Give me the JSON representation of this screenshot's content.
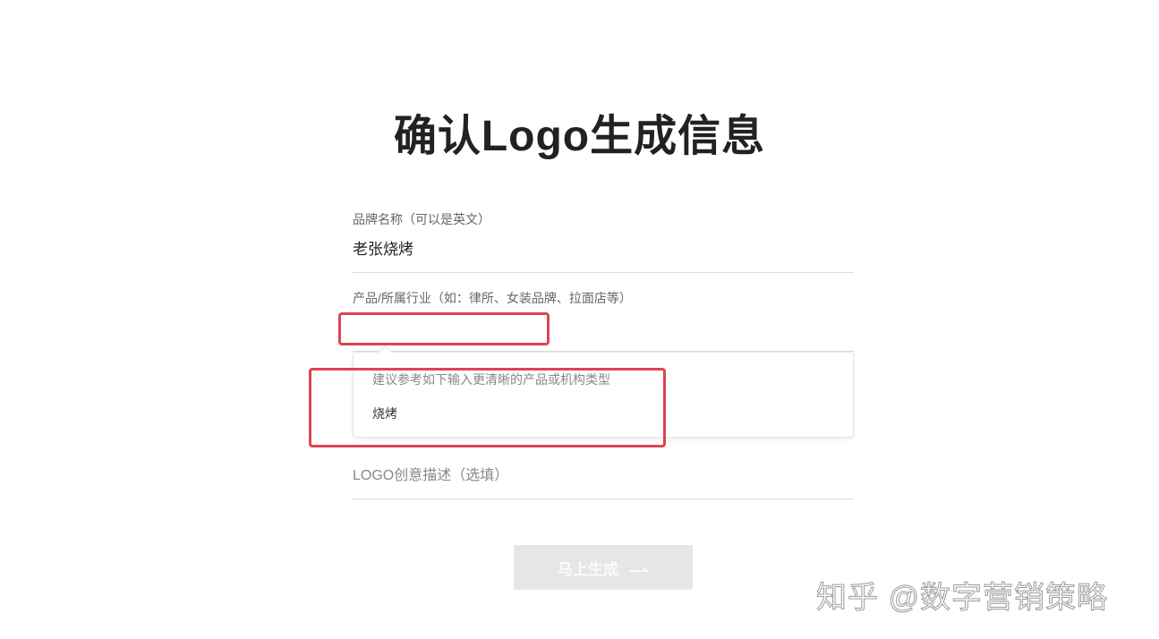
{
  "page": {
    "title": "确认Logo生成信息"
  },
  "form": {
    "brand": {
      "label": "品牌名称（可以是英文）",
      "value": "老张烧烤"
    },
    "industry": {
      "label": "产品/所属行业（如：律所、女装品牌、拉面店等）",
      "value": ""
    },
    "suggestions": {
      "hint": "建议参考如下输入更清晰的产品或机构类型",
      "items": [
        "烧烤"
      ]
    },
    "description": {
      "placeholder": "LOGO创意描述（选填）",
      "value": ""
    },
    "submit_label": "马上生成"
  },
  "watermark": "知乎 @数字营销策略",
  "colors": {
    "highlight": "#e04352",
    "button_bg": "#e6e6e6"
  }
}
